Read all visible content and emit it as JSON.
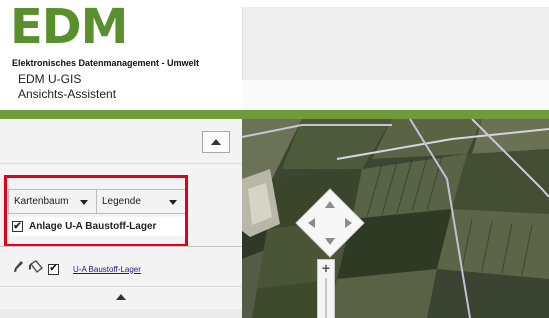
{
  "header": {
    "logo": "EDM",
    "subtitle": "Elektronisches Datenmanagement - Umwelt",
    "app_name": "EDM U-GIS",
    "app_sub": "Ansichts-Assistent"
  },
  "colors": {
    "brand_green": "#5a8f2e",
    "bar_green": "#6f9b3a",
    "highlight_red": "#e3001b"
  },
  "left_panel": {
    "selects": {
      "kartenbaum": "Kartenbaum",
      "legende": "Legende"
    },
    "checked_layer": {
      "label": "Anlage U-A Baustoff-Lager",
      "checked": true
    },
    "layer_row": {
      "link": "U-A Baustoff-Lager",
      "checked": true
    }
  },
  "map": {
    "zoom_in_symbol": "+"
  }
}
